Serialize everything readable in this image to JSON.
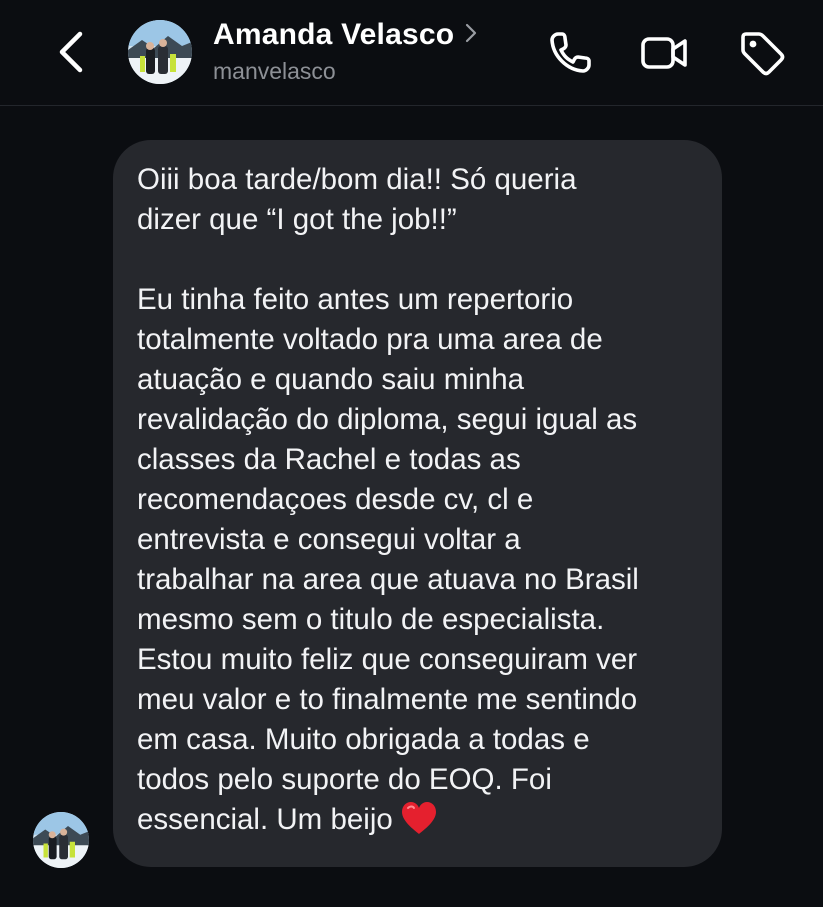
{
  "header": {
    "back_icon": "chevron-left-icon",
    "contact_name": "Amanda Velasco",
    "contact_handle": "manvelasco",
    "call_icon": "phone-icon",
    "video_icon": "video-camera-icon",
    "tag_icon": "tag-icon"
  },
  "message": {
    "paragraph1": "Oiii boa tarde/bom dia!! Só queria\ndizer que “I got the job!!”",
    "paragraph2": "Eu tinha feito antes um repertorio\ntotalmente voltado pra uma area de\natuação e quando saiu minha\nrevalidação do diploma, segui igual as\nclasses da Rachel e todas as\nrecomendaçoes desde cv, cl e\nentrevista e consegui voltar a\ntrabalhar na area que atuava no Brasil\nmesmo sem o titulo de especialista.\nEstou muito feliz que conseguiram ver\nmeu valor e to finalmente me sentindo\nem casa. Muito obrigada a todas e\ntodos pelo suporte do EOQ. Foi\nessencial. Um beijo",
    "emoji": "red-heart-icon"
  },
  "colors": {
    "background": "#0b0d11",
    "bubble": "#26282d",
    "handle_text": "#8d9096"
  }
}
